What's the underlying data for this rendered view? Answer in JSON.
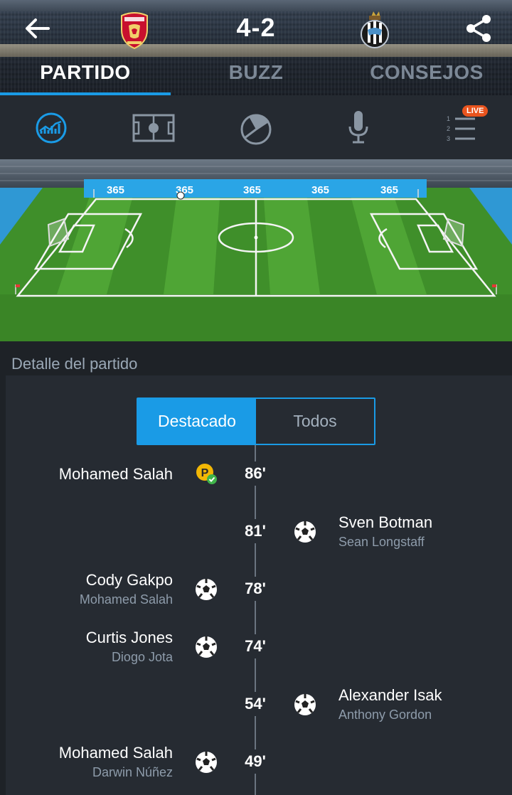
{
  "header": {
    "score": "4-2",
    "home_crest": "liverpool-crest",
    "away_crest": "newcastle-crest",
    "tabs": [
      {
        "label": "PARTIDO",
        "active": true
      },
      {
        "label": "BUZZ",
        "active": false
      },
      {
        "label": "CONSEJOS",
        "active": false
      }
    ]
  },
  "iconbar": {
    "items": [
      "stats-icon",
      "pitch-icon",
      "possession-chart-icon",
      "microphone-icon",
      "live-standings-icon"
    ],
    "live_badge": "LIVE",
    "standings_numbers": [
      "1",
      "2",
      "3"
    ]
  },
  "pitch": {
    "ad_text": "365",
    "ad_count": 5
  },
  "section": {
    "title": "Detalle del partido",
    "toggle": {
      "selected": "Destacado",
      "other": "Todos"
    }
  },
  "events": [
    {
      "minute": "86'",
      "side": "home",
      "player": "Mohamed Salah",
      "assist": "",
      "icon": "penalty-scored-icon"
    },
    {
      "minute": "81'",
      "side": "away",
      "player": "Sven Botman",
      "assist": "Sean Longstaff",
      "icon": "goal-ball-icon"
    },
    {
      "minute": "78'",
      "side": "home",
      "player": "Cody Gakpo",
      "assist": "Mohamed Salah",
      "icon": "goal-ball-icon"
    },
    {
      "minute": "74'",
      "side": "home",
      "player": "Curtis Jones",
      "assist": "Diogo Jota",
      "icon": "goal-ball-icon"
    },
    {
      "minute": "54'",
      "side": "away",
      "player": "Alexander Isak",
      "assist": "Anthony Gordon",
      "icon": "goal-ball-icon"
    },
    {
      "minute": "49'",
      "side": "home",
      "player": "Mohamed Salah",
      "assist": "Darwin Núñez",
      "icon": "goal-ball-icon"
    }
  ],
  "colors": {
    "accent": "#1a9be6",
    "live": "#e9541e",
    "background": "#1e2227"
  }
}
